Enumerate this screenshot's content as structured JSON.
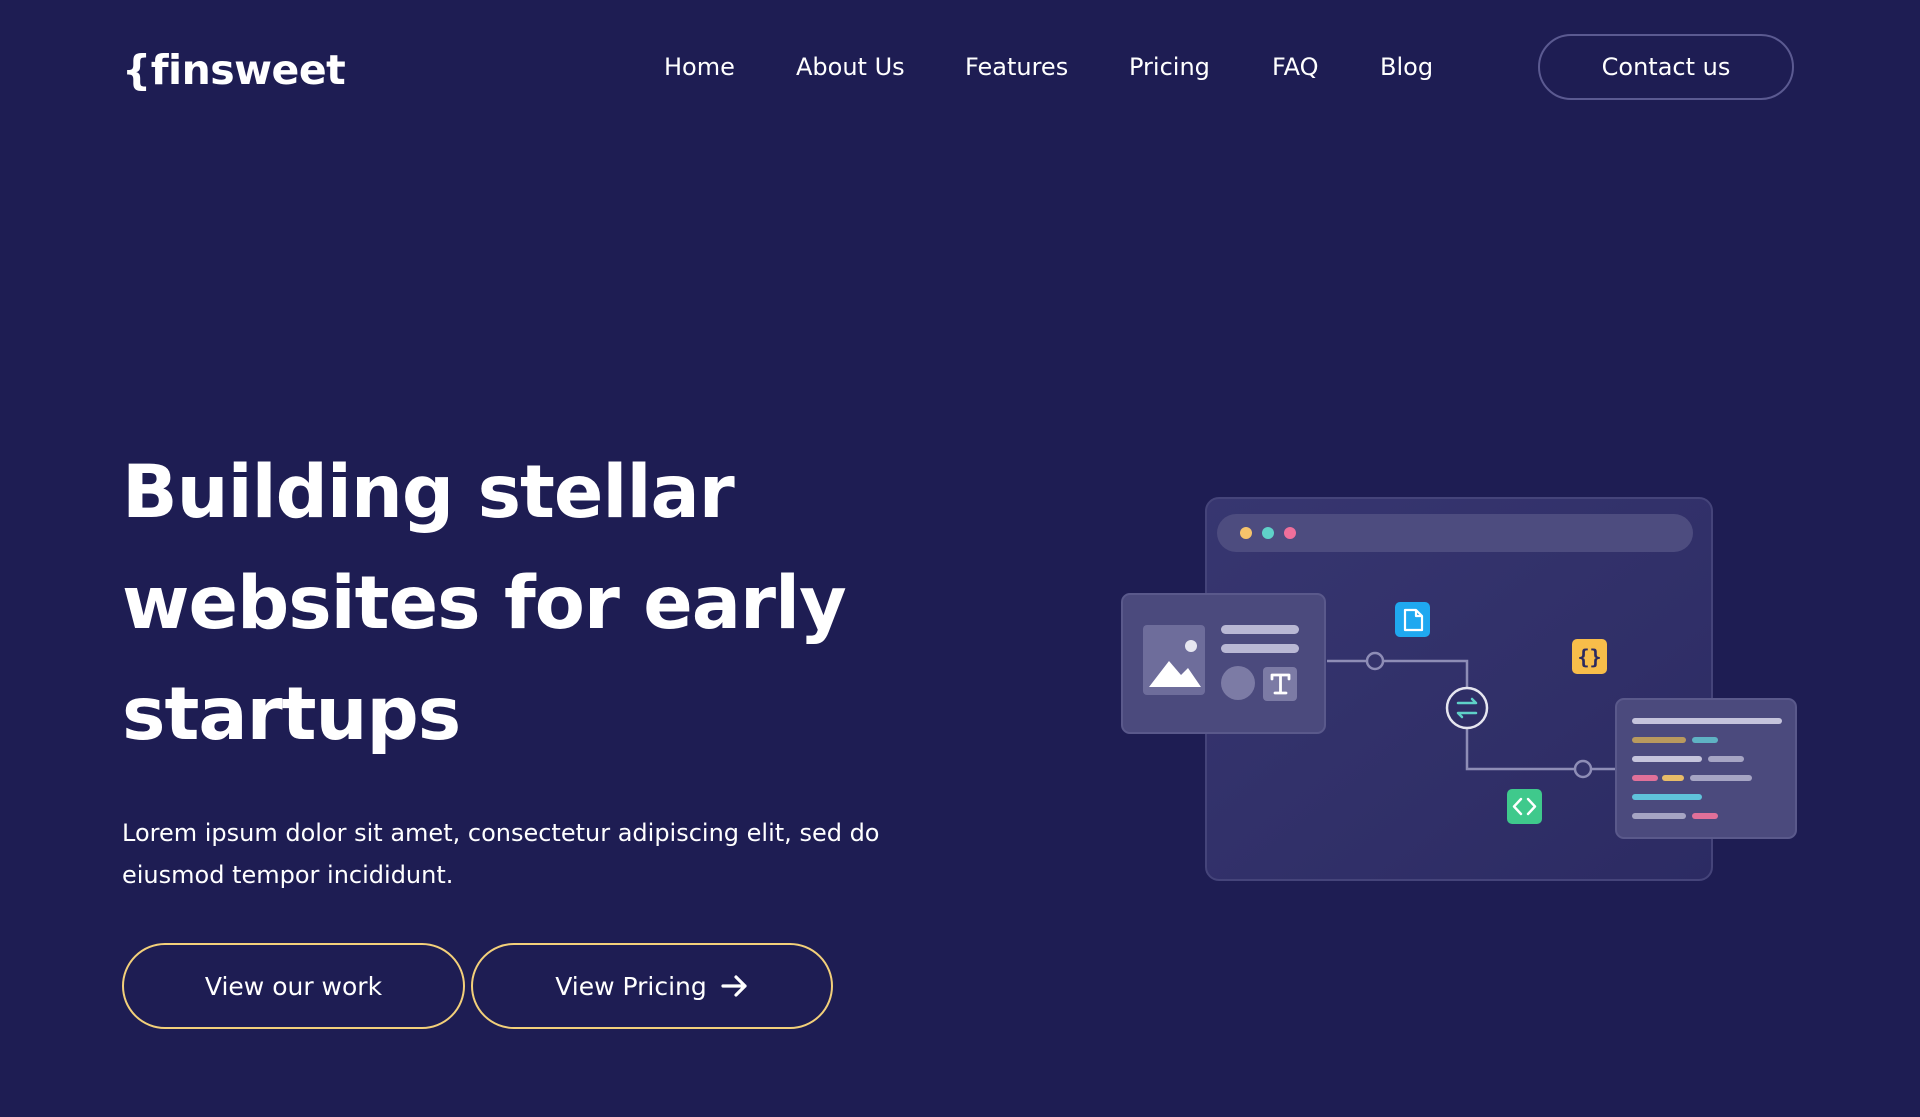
{
  "header": {
    "logo_text": "{finsweet",
    "nav": [
      "Home",
      "About Us",
      "Features",
      "Pricing",
      "FAQ",
      "Blog"
    ],
    "contact_label": "Contact us"
  },
  "hero": {
    "title_lines": [
      "Building stellar",
      "websites for early",
      "startups"
    ],
    "subtitle_lines": [
      "Lorem ipsum dolor sit amet, consectetur adipiscing elit, sed do",
      "eiusmod tempor incididunt."
    ],
    "buttons": {
      "work_label": "View our work",
      "pricing_label": "View Pricing",
      "pricing_icon": "arrow-right-icon"
    }
  },
  "illustration": {
    "icons": [
      "image-icon",
      "text-icon",
      "file-icon",
      "braces-icon",
      "sync-icon",
      "code-icon"
    ]
  },
  "colors": {
    "background": "#1e1d53",
    "accent": "#f3d07a",
    "contact_border": "#5b5a91",
    "window": "#34336b",
    "window_bar": "#4d4c7f",
    "dot_yellow": "#f5c36b",
    "dot_teal": "#5fd1c8",
    "dot_pink": "#ef6f9b",
    "file_icon_bg": "#1fa8f0",
    "braces_icon_bg": "#f7bd4a",
    "code_icon_bg": "#3fc98c"
  }
}
